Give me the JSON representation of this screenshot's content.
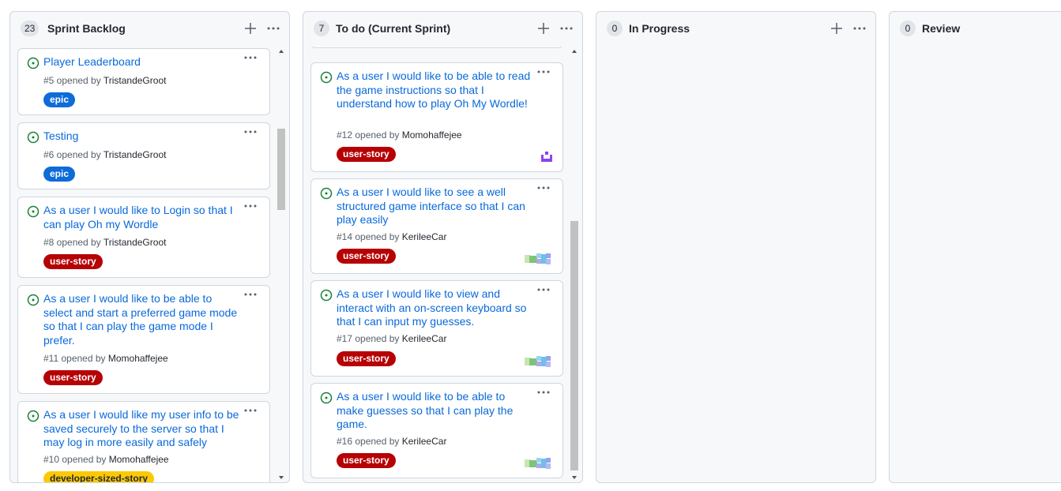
{
  "columns": [
    {
      "count": "23",
      "title": "Sprint Backlog",
      "cards": [
        {
          "title": "Player Leaderboard",
          "meta_prefix": "#5 opened by ",
          "author": "TristandeGroot",
          "label": "epic",
          "label_bg": "#0e6bd8",
          "label_fg": "#ffffff"
        },
        {
          "title": "Testing",
          "meta_prefix": "#6 opened by ",
          "author": "TristandeGroot",
          "label": "epic",
          "label_bg": "#0e6bd8",
          "label_fg": "#ffffff"
        },
        {
          "title": "As a user I would like to Login so that I can play Oh my Wordle",
          "meta_prefix": "#8 opened by ",
          "author": "TristandeGroot",
          "label": "user-story",
          "label_bg": "#b60205",
          "label_fg": "#ffffff"
        },
        {
          "title": "As a user I would like to be able to select and start a preferred game mode so that I can play the game mode I prefer.",
          "meta_prefix": "#11 opened by ",
          "author": "Momohaffejee",
          "label": "user-story",
          "label_bg": "#b60205",
          "label_fg": "#ffffff"
        },
        {
          "title": "As a user I would like my user info to be saved securely to the server so that I may log in more easily and safely",
          "meta_prefix": "#10 opened by ",
          "author": "Momohaffejee",
          "label": "developer-sized-story",
          "label_bg": "#fbca04",
          "label_fg": "#24292f"
        }
      ]
    },
    {
      "count": "7",
      "title": "To do (Current Sprint)",
      "cards": [
        {
          "title": "As a user I would like to be able to read the game instructions so that I understand how to play Oh My Wordle!",
          "meta_prefix": "#12 opened by ",
          "author": "Momohaffejee",
          "label": "user-story",
          "label_bg": "#b60205",
          "label_fg": "#ffffff",
          "avatar": "purple-identicon"
        },
        {
          "title": "As a user I would like to see a well structured game interface so that I can play easily",
          "meta_prefix": "#14 opened by ",
          "author": "KerileeCar",
          "label": "user-story",
          "label_bg": "#b60205",
          "label_fg": "#ffffff",
          "avatar": "multicolor-identicon"
        },
        {
          "title": "As a user I would like to view and interact with an on-screen keyboard so that I can input my guesses.",
          "meta_prefix": "#17 opened by ",
          "author": "KerileeCar",
          "label": "user-story",
          "label_bg": "#b60205",
          "label_fg": "#ffffff",
          "avatar": "multicolor-identicon"
        },
        {
          "title": "As a user I would like to be able to make guesses so that I can play the game.",
          "meta_prefix": "#16 opened by ",
          "author": "KerileeCar",
          "label": "user-story",
          "label_bg": "#b60205",
          "label_fg": "#ffffff",
          "avatar": "multicolor-identicon"
        }
      ]
    },
    {
      "count": "0",
      "title": "In Progress",
      "cards": []
    },
    {
      "count": "0",
      "title": "Review",
      "cards": []
    }
  ],
  "icons": {
    "add": "plus-icon",
    "menu": "kebab-horizontal-icon",
    "issue": "issue-opened-icon",
    "scroll_up": "scroll-up-arrow-icon",
    "scroll_down": "scroll-down-arrow-icon"
  },
  "colors": {
    "link": "#0969da",
    "issue_open": "#1a7f37",
    "column_bg": "#f6f8fa",
    "border": "#d0d7de"
  }
}
